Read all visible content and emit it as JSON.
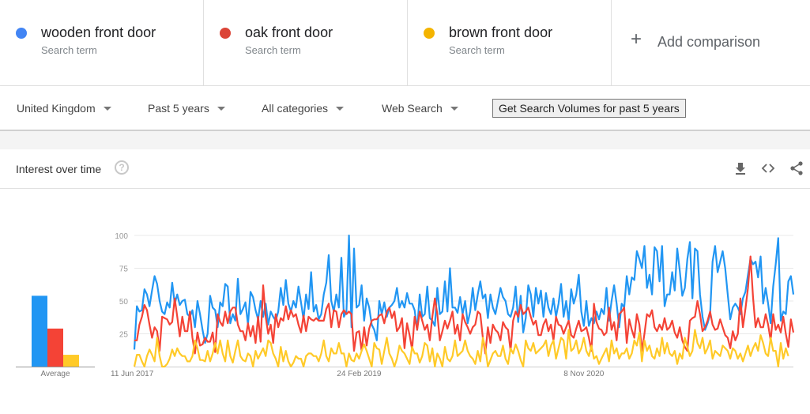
{
  "terms": [
    {
      "name": "wooden front door",
      "sub": "Search term",
      "color": "#4285f4"
    },
    {
      "name": "oak front door",
      "sub": "Search term",
      "color": "#db4437"
    },
    {
      "name": "brown front door",
      "sub": "Search term",
      "color": "#f4b400"
    }
  ],
  "add_comparison": {
    "icon": "+",
    "label": "Add comparison"
  },
  "filters": {
    "region": "United Kingdom",
    "time": "Past 5 years",
    "category": "All categories",
    "search_type": "Web Search"
  },
  "volume_button": "Get Search Volumes for past 5 years",
  "card": {
    "title": "Interest over time",
    "help_icon": "?",
    "actions": [
      "download-icon",
      "embed-icon",
      "share-icon"
    ]
  },
  "chart_data": [
    {
      "type": "bar",
      "title": "Average",
      "categories": [
        "wooden front door",
        "oak front door",
        "brown front door"
      ],
      "values": [
        54,
        29,
        9
      ],
      "colors": [
        "#2196f3",
        "#f44336",
        "#ffca28"
      ],
      "ylim": [
        0,
        100
      ]
    },
    {
      "type": "line",
      "title": "Interest over time",
      "xlabel": "",
      "ylabel": "",
      "ylim": [
        0,
        100
      ],
      "yticks": [
        25,
        50,
        75,
        100
      ],
      "grid": true,
      "x_tick_labels": [
        {
          "label": "11 Jun 2017",
          "week": 0
        },
        {
          "label": "24 Feb 2019",
          "week": 89
        },
        {
          "label": "8 Nov 2020",
          "week": 178
        }
      ],
      "x_start": "11 Jun 2017",
      "x_unit": "week",
      "series": [
        {
          "name": "wooden front door",
          "color": "#2196f3",
          "values": [
            13,
            46,
            42,
            43,
            59,
            55,
            46,
            58,
            69,
            63,
            50,
            42,
            40,
            49,
            45,
            64,
            48,
            55,
            47,
            50,
            51,
            40,
            38,
            43,
            30,
            50,
            40,
            28,
            18,
            25,
            54,
            45,
            43,
            30,
            49,
            46,
            63,
            61,
            33,
            40,
            35,
            67,
            40,
            44,
            49,
            32,
            57,
            53,
            43,
            36,
            50,
            38,
            48,
            32,
            42,
            38,
            35,
            42,
            60,
            47,
            66,
            48,
            42,
            50,
            45,
            61,
            49,
            36,
            55,
            44,
            72,
            42,
            47,
            36,
            40,
            55,
            64,
            85,
            50,
            42,
            55,
            45,
            83,
            38,
            42,
            100,
            30,
            90,
            45,
            47,
            62,
            35,
            52,
            45,
            32,
            28,
            20,
            50,
            40,
            49,
            38,
            45,
            47,
            50,
            60,
            45,
            50,
            45,
            56,
            48,
            48,
            43,
            28,
            55,
            38,
            40,
            61,
            37,
            35,
            31,
            60,
            40,
            42,
            65,
            42,
            75,
            45,
            45,
            41,
            53,
            40,
            50,
            33,
            42,
            60,
            43,
            55,
            65,
            52,
            55,
            37,
            55,
            45,
            40,
            50,
            60,
            53,
            50,
            40,
            38,
            45,
            61,
            34,
            54,
            26,
            37,
            62,
            55,
            38,
            60,
            48,
            58,
            38,
            56,
            45,
            40,
            52,
            38,
            48,
            63,
            38,
            50,
            35,
            59,
            48,
            55,
            70,
            42,
            31,
            50,
            31,
            37,
            33,
            42,
            36,
            44,
            40,
            60,
            35,
            50,
            62,
            48,
            30,
            48,
            45,
            69,
            55,
            68,
            66,
            88,
            82,
            75,
            92,
            60,
            70,
            55,
            91,
            88,
            65,
            92,
            46,
            55,
            55,
            72,
            58,
            90,
            73,
            54,
            60,
            82,
            95,
            52,
            90,
            88,
            55,
            38,
            28,
            33,
            40,
            80,
            92,
            72,
            80,
            88,
            75,
            55,
            36,
            45,
            48,
            45,
            40,
            52,
            57,
            70,
            82,
            78,
            80,
            68,
            84,
            48,
            60,
            48,
            33,
            61,
            78,
            98,
            35,
            42,
            40,
            65,
            69,
            55
          ]
        },
        {
          "name": "oak front door",
          "color": "#f44336",
          "values": [
            20,
            20,
            32,
            38,
            47,
            43,
            32,
            22,
            30,
            27,
            12,
            38,
            37,
            36,
            32,
            34,
            52,
            38,
            23,
            38,
            27,
            27,
            42,
            22,
            10,
            26,
            16,
            17,
            22,
            19,
            19,
            26,
            11,
            40,
            34,
            31,
            42,
            33,
            42,
            45,
            45,
            32,
            27,
            27,
            20,
            33,
            23,
            31,
            18,
            38,
            19,
            62,
            38,
            25,
            32,
            18,
            40,
            30,
            37,
            35,
            46,
            36,
            43,
            38,
            40,
            32,
            26,
            39,
            27,
            38,
            36,
            35,
            37,
            35,
            35,
            35,
            44,
            48,
            30,
            43,
            42,
            30,
            40,
            43,
            40,
            42,
            40,
            12,
            26,
            27,
            12,
            30,
            16,
            29,
            35,
            36,
            36,
            39,
            40,
            33,
            42,
            45,
            37,
            42,
            27,
            30,
            37,
            14,
            33,
            24,
            13,
            38,
            28,
            42,
            35,
            28,
            32,
            20,
            38,
            52,
            40,
            20,
            27,
            35,
            29,
            35,
            42,
            25,
            32,
            20,
            40,
            34,
            30,
            25,
            30,
            32,
            42,
            40,
            22,
            10,
            30,
            18,
            32,
            28,
            26,
            20,
            34,
            30,
            28,
            12,
            35,
            42,
            38,
            47,
            40,
            42,
            45,
            38,
            32,
            35,
            24,
            24,
            32,
            36,
            27,
            32,
            20,
            38,
            32,
            31,
            25,
            30,
            35,
            24,
            22,
            29,
            35,
            27,
            28,
            30,
            22,
            12,
            48,
            34,
            29,
            28,
            24,
            26,
            45,
            28,
            34,
            20,
            40,
            42,
            45,
            18,
            36,
            28,
            22,
            40,
            32,
            12,
            25,
            40,
            38,
            43,
            30,
            27,
            32,
            28,
            37,
            28,
            30,
            35,
            26,
            22,
            30,
            20,
            15,
            12,
            35,
            37,
            38,
            50,
            40,
            27,
            30,
            35,
            42,
            32,
            28,
            29,
            36,
            30,
            24,
            22,
            14,
            27,
            20,
            25,
            52,
            30,
            44,
            60,
            84,
            53,
            30,
            37,
            30,
            30,
            40,
            32,
            20,
            40,
            28,
            32,
            26,
            38,
            25,
            15,
            36,
            26
          ]
        },
        {
          "name": "brown front door",
          "color": "#ffca28",
          "values": [
            0,
            9,
            9,
            4,
            0,
            8,
            13,
            9,
            4,
            22,
            8,
            0,
            0,
            2,
            6,
            13,
            8,
            14,
            10,
            8,
            8,
            4,
            4,
            8,
            20,
            14,
            5,
            5,
            4,
            12,
            4,
            10,
            18,
            10,
            20,
            10,
            4,
            20,
            8,
            3,
            12,
            20,
            8,
            5,
            4,
            10,
            8,
            0,
            12,
            6,
            10,
            14,
            8,
            20,
            18,
            10,
            6,
            0,
            15,
            4,
            12,
            4,
            0,
            3,
            8,
            6,
            6,
            0,
            8,
            10,
            10,
            8,
            8,
            4,
            10,
            20,
            8,
            4,
            14,
            10,
            10,
            18,
            10,
            10,
            0,
            10,
            5,
            4,
            10,
            6,
            12,
            17,
            12,
            6,
            0,
            18,
            14,
            13,
            2,
            12,
            22,
            10,
            6,
            0,
            6,
            16,
            12,
            10,
            6,
            2,
            15,
            10,
            10,
            3,
            8,
            18,
            16,
            4,
            14,
            0,
            10,
            6,
            0,
            15,
            6,
            4,
            8,
            20,
            8,
            10,
            12,
            20,
            12,
            8,
            6,
            2,
            12,
            4,
            22,
            14,
            0,
            5,
            10,
            12,
            8,
            8,
            16,
            6,
            2,
            14,
            10,
            17,
            12,
            5,
            0,
            20,
            14,
            12,
            18,
            10,
            12,
            14,
            16,
            20,
            8,
            16,
            20,
            6,
            14,
            22,
            20,
            6,
            28,
            12,
            14,
            20,
            10,
            14,
            22,
            12,
            8,
            16,
            6,
            8,
            2,
            6,
            10,
            14,
            4,
            20,
            10,
            14,
            6,
            10,
            10,
            14,
            6,
            10,
            20,
            16,
            26,
            4,
            20,
            12,
            16,
            8,
            6,
            14,
            8,
            22,
            10,
            18,
            10,
            8,
            12,
            2,
            10,
            6,
            22,
            15,
            8,
            12,
            28,
            18,
            14,
            22,
            10,
            14,
            20,
            6,
            12,
            10,
            8,
            16,
            14,
            12,
            6,
            14,
            12,
            6,
            10,
            4,
            10,
            16,
            8,
            14,
            18,
            12,
            24,
            18,
            10,
            8,
            22,
            12,
            12,
            0,
            18,
            6,
            14,
            8
          ]
        }
      ]
    }
  ]
}
